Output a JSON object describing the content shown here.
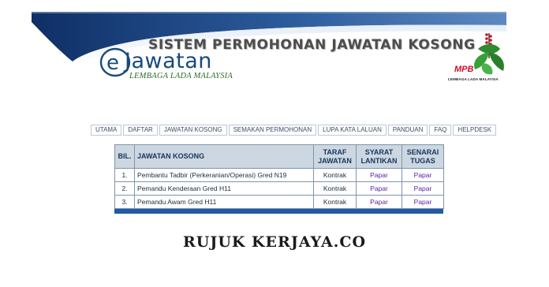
{
  "header": {
    "system_title": "SISTEM PERMOHONAN JAWATAN KOSONG",
    "logo_main": "Jawatan",
    "logo_sub": "LEMBAGA LADA MALAYSIA",
    "agency_logo_text": "MPB",
    "agency_logo_sub": "LEMBAGA LADA MALAYSIA"
  },
  "nav": {
    "items": [
      "UTAMA",
      "DAFTAR",
      "JAWATAN KOSONG",
      "SEMAKAN PERMOHONAN",
      "LUPA KATA LALUAN",
      "PANDUAN",
      "FAQ",
      "HELPDESK"
    ]
  },
  "table": {
    "headers": {
      "bil": "BIL.",
      "jawatan": "JAWATAN KOSONG",
      "taraf_1": "TARAF",
      "taraf_2": "JAWATAN",
      "syarat_1": "SYARAT",
      "syarat_2": "LANTIKAN",
      "senarai_1": "SENARAI",
      "senarai_2": "TUGAS"
    },
    "rows": [
      {
        "no": "1.",
        "jawatan": "Pembantu Tadbir (Perkeranian/Operasi) Gred N19",
        "taraf": "Kontrak",
        "syarat": "Papar",
        "tugas": "Papar"
      },
      {
        "no": "2.",
        "jawatan": "Pemandu Kenderaan Gred H11",
        "taraf": "Kontrak",
        "syarat": "Papar",
        "tugas": "Papar"
      },
      {
        "no": "3.",
        "jawatan": "Pemandu Awam Gred H11",
        "taraf": "Kontrak",
        "syarat": "Papar",
        "tugas": "Papar"
      }
    ]
  },
  "footer": {
    "watermark": "RUJUK KERJAYA.CO"
  },
  "colors": {
    "banner_dark": "#1a3d7a",
    "table_header_bg": "#ccd7e1",
    "link": "#5a1fa0",
    "table_footer_bar": "#1f5aa8"
  }
}
